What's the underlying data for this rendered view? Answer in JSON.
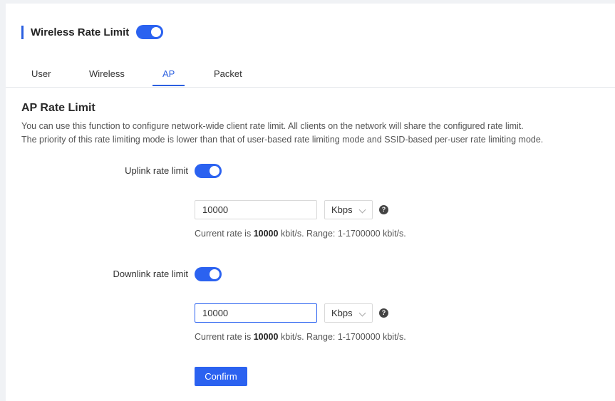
{
  "header": {
    "title": "Wireless Rate Limit",
    "enabled": true
  },
  "tabs": [
    {
      "label": "User",
      "active": false
    },
    {
      "label": "Wireless",
      "active": false
    },
    {
      "label": "AP",
      "active": true
    },
    {
      "label": "Packet",
      "active": false
    }
  ],
  "section": {
    "title": "AP Rate Limit",
    "description_1": "You can use this function to configure network-wide client rate limit. All clients on the network will share the configured rate limit.",
    "description_2": "The priority of this rate limiting mode is lower than that of user-based rate limiting mode and SSID-based per-user rate limiting mode."
  },
  "uplink": {
    "label": "Uplink rate limit",
    "enabled": true,
    "value": "10000",
    "unit": "Kbps",
    "info_prefix": "Current rate is",
    "info_value": "10000",
    "info_suffix": "kbit/s. Range: 1-1700000 kbit/s."
  },
  "downlink": {
    "label": "Downlink rate limit",
    "enabled": true,
    "value": "10000",
    "unit": "Kbps",
    "info_prefix": "Current rate is",
    "info_value": "10000",
    "info_suffix": "kbit/s. Range: 1-1700000 kbit/s."
  },
  "actions": {
    "confirm_label": "Confirm"
  },
  "colors": {
    "accent": "#2b62f0",
    "page_background": "#f0f2f5"
  },
  "icons": {
    "help": "question-circle-icon",
    "dropdown": "chevron-down-icon"
  }
}
